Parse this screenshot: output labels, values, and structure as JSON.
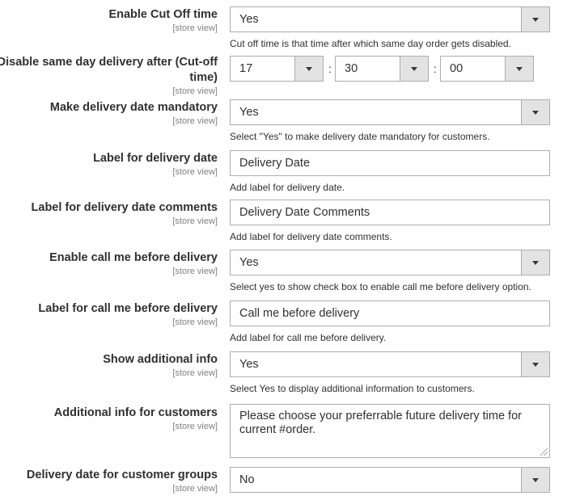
{
  "scope_label": "[store view]",
  "fields": [
    {
      "label": "Enable Cut Off time",
      "value": "Yes",
      "note": "Cut off time is that time after which same day order gets disabled."
    },
    {
      "label": "Disable same day delivery after (Cut-off time)",
      "label_line1": "Disable same day delivery after (Cut-off",
      "label_line2": "time)",
      "hour": "17",
      "minute": "30",
      "second": "00",
      "separator": ":"
    },
    {
      "label": "Make delivery date mandatory",
      "value": "Yes",
      "note": "Select \"Yes\" to make delivery date mandatory for customers."
    },
    {
      "label": "Label for delivery date",
      "value": "Delivery Date",
      "note": "Add label for delivery date."
    },
    {
      "label": "Label for delivery date comments",
      "value": "Delivery Date Comments",
      "note": "Add label for delivery date comments."
    },
    {
      "label": "Enable call me before delivery",
      "value": "Yes",
      "note": "Select yes to show check box to enable call me before delivery option."
    },
    {
      "label": "Label for call me before delivery",
      "value": "Call me before delivery",
      "note": "Add label for call me before delivery."
    },
    {
      "label": "Show additional info",
      "value": "Yes",
      "note": "Select Yes to display additional information to customers."
    },
    {
      "label": "Additional info for customers",
      "value": "Please choose your preferrable future delivery time for current #order."
    },
    {
      "label": "Delivery date for customer groups",
      "value": "No"
    }
  ]
}
